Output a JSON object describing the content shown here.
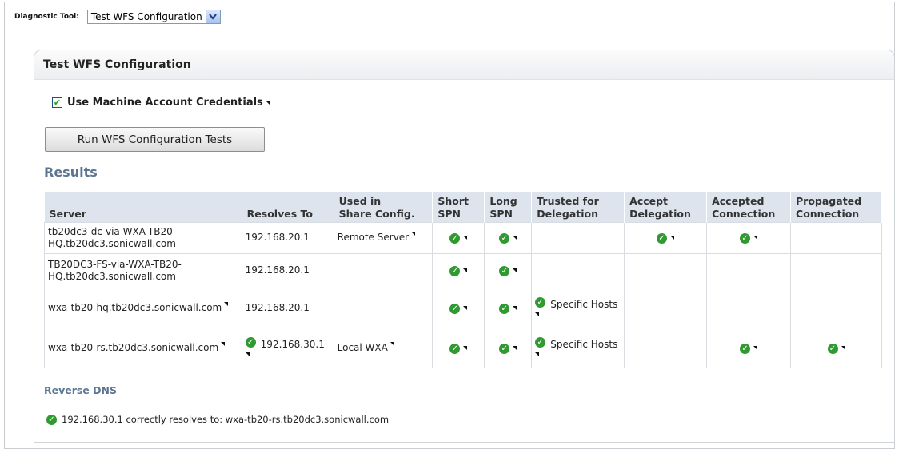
{
  "diagnostic": {
    "label": "Diagnostic Tool:",
    "selected": "Test WFS Configuration"
  },
  "panel": {
    "title": "Test WFS Configuration",
    "checkbox_label": "Use Machine Account Credentials",
    "checkbox_checked": true,
    "run_button": "Run WFS Configuration Tests",
    "results_title": "Results"
  },
  "table": {
    "headers": {
      "server": "Server",
      "resolves": "Resolves To",
      "used_l1": "Used in",
      "used_l2": "Share Config.",
      "short_l1": "Short",
      "short_l2": "SPN",
      "long_l1": "Long",
      "long_l2": "SPN",
      "trusted_l1": "Trusted for",
      "trusted_l2": "Delegation",
      "accept_l1": "Accept",
      "accept_l2": "Delegation",
      "accepted_l1": "Accepted",
      "accepted_l2": "Connection",
      "prop_l1": "Propagated",
      "prop_l2": "Connection"
    },
    "rows": [
      {
        "server_l1": "tb20dc3-dc-via-WXA-TB20-",
        "server_l2": "HQ.tb20dc3.sonicwall.com",
        "resolves": "192.168.20.1",
        "used": "Remote Server",
        "trusted": ""
      },
      {
        "server_l1": "TB20DC3-FS-via-WXA-TB20-",
        "server_l2": "HQ.tb20dc3.sonicwall.com",
        "resolves": "192.168.20.1",
        "used": "",
        "trusted": ""
      },
      {
        "server_l1": "wxa-tb20-hq.tb20dc3.sonicwall.com",
        "server_l2": "",
        "resolves": "192.168.20.1",
        "used": "",
        "trusted": "Specific Hosts"
      },
      {
        "server_l1": "wxa-tb20-rs.tb20dc3.sonicwall.com",
        "server_l2": "",
        "resolves": "192.168.30.1",
        "used": "Local WXA",
        "trusted": "Specific Hosts"
      }
    ]
  },
  "reverse_dns": {
    "title": "Reverse DNS",
    "line": "192.168.30.1 correctly resolves to: wxa-tb20-rs.tb20dc3.sonicwall.com"
  },
  "colors": {
    "ok_green": "#2f9a2f",
    "section_blue": "#5a7691",
    "header_bg": "#dde4ee"
  },
  "icons": {
    "ok": "check-circle-icon",
    "tooltip": "tooltip-corner-icon",
    "dropdown": "chevron-down-icon"
  }
}
